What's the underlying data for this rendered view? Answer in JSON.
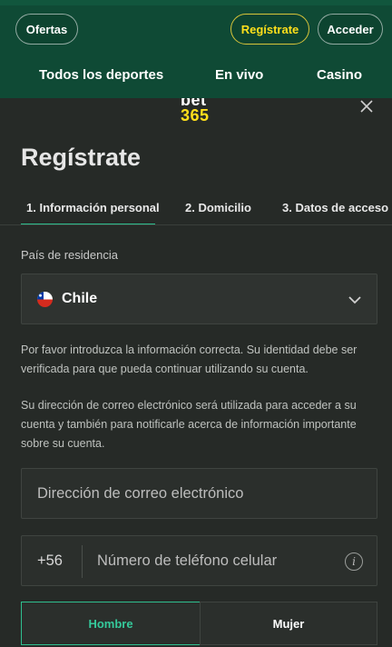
{
  "header": {
    "offers_label": "Ofertas",
    "register_label": "Regístrate",
    "login_label": "Acceder",
    "nav": [
      "Todos los deportes",
      "En vivo",
      "Casino"
    ]
  },
  "modal": {
    "logo_top": "bet",
    "logo_bottom": "365",
    "title": "Regístrate",
    "tabs": [
      "1. Información personal",
      "2. Domicilio",
      "3. Datos de acceso"
    ],
    "country_label": "País de residencia",
    "country_value": "Chile",
    "info_text_1": "Por favor introduzca la información correcta. Su identidad debe ser verificada para que pueda continuar utilizando su cuenta.",
    "info_text_2": "Su dirección de correo electrónico será utilizada para acceder a su cuenta y también para notificarle acerca de información importante sobre su cuenta.",
    "email_placeholder": "Dirección de correo electrónico",
    "phone_prefix": "+56",
    "phone_placeholder": "Número de teléfono celular",
    "info_icon_glyph": "i",
    "gender_male": "Hombre",
    "gender_female": "Mujer"
  },
  "colors": {
    "header_bg": "#0f4a35",
    "brand_yellow": "#ffdf1b",
    "accent_green": "#2fbf8f",
    "modal_bg": "#262a27"
  },
  "icons": [
    "close-icon",
    "chile-flag-icon",
    "chevron-down-icon",
    "info-icon"
  ]
}
